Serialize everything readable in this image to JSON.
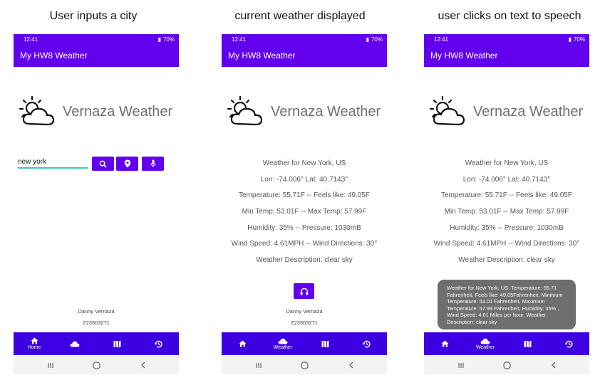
{
  "captions": [
    "User inputs a city",
    "current weather displayed",
    "user clicks on text to speech"
  ],
  "status": {
    "time": "12:41",
    "battery": "70%"
  },
  "app": {
    "title": "My HW8 Weather",
    "logo_text": "Vernaza Weather"
  },
  "search": {
    "value": "new york"
  },
  "weather": {
    "location": "Weather for New York, US",
    "coords": "Lon: -74.006° Lat: 40.7143°",
    "temperature": "Temperature: 55.71F -- Feels like: 49.05F",
    "minmax": "Min Temp: 53.01F -- Max Temp: 57.99F",
    "humidity": "Humidity: 35% -- Pressure: 1030mB",
    "wind": "Wind Speed: 4.61MPH -- Wind Directions: 30°",
    "description": "Weather Description: clear sky"
  },
  "toast": {
    "text": "Weather for New York, US, Temperature: 55.71 Fahrenheit, Feels like: 49.05Fahrenheit, Minimum Temperature: 53.01 Fahrenheit, Maximum Temperature: 57.99 Fahrenheit, Humidity: 35% , Wind Speed: 4.61 Miles per hour, Weather Description: clear sky"
  },
  "author": {
    "name": "Danny Vernaza",
    "id": "Z23503271"
  },
  "nav": {
    "home_label": "Home",
    "weather_label": "Weather"
  },
  "colors": {
    "primary": "#6200ee",
    "bottom_nav": "#3d00e0",
    "input_underline": "#3cc5bd",
    "toast_bg": "#6e6e6e"
  },
  "icons": [
    "search-icon",
    "location-pin-icon",
    "mic-icon",
    "headphones-icon",
    "home-icon",
    "cloud-icon",
    "map-icon",
    "history-icon"
  ]
}
